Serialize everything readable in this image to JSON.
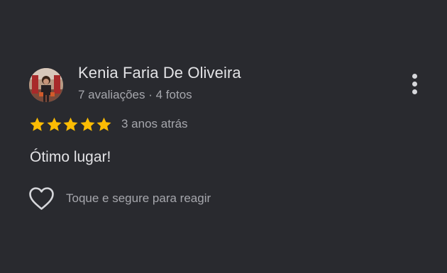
{
  "review": {
    "author_name": "Kenia Faria De Oliveira",
    "author_meta": "7 avaliações · 4 fotos",
    "rating": 5,
    "rating_max": 5,
    "date": "3 anos atrás",
    "text": "Ótimo lugar!",
    "react_label": "Toque e segure para reagir"
  },
  "icons": {
    "avatar": "profile-photo",
    "more": "more-vertical-icon",
    "star": "star-icon",
    "react": "heart-outline-icon"
  },
  "colors": {
    "background": "#292a2f",
    "star": "#fbbc04",
    "primary_text": "#e3e3e6",
    "secondary_text": "#a6a7ad"
  }
}
